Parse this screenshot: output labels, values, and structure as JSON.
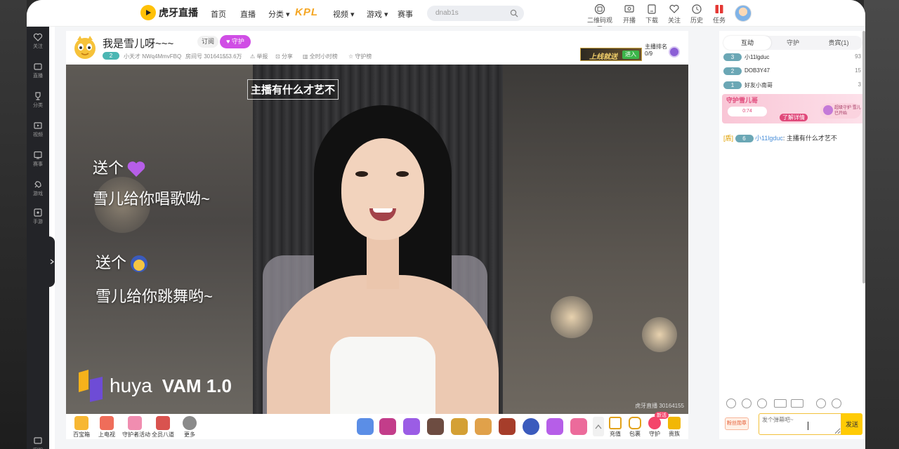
{
  "topnav": {
    "logo_text": "虎牙直播",
    "items": [
      "首页",
      "直播",
      "分类",
      "视频",
      "游戏",
      "赛事"
    ],
    "kpl": "KPL",
    "search_placeholder": "dnab1s",
    "icons": [
      {
        "label": "二维码观看"
      },
      {
        "label": "开播"
      },
      {
        "label": "下载"
      },
      {
        "label": "关注"
      },
      {
        "label": "历史"
      },
      {
        "label": "任务"
      }
    ]
  },
  "sidebar": {
    "items": [
      "关注",
      "直播",
      "分类",
      "视频",
      "赛事",
      "游戏",
      "手游"
    ],
    "bottom": "客服"
  },
  "room": {
    "title": "我是雪儿呀~~~",
    "subscribe": "订阅",
    "guard": "守护",
    "level": "2",
    "meta": [
      "小天才 NWq4MmvFBQ",
      "房间号 30164155",
      "3.6万",
      "举报",
      "分享",
      "全时小时榜",
      "守护榜"
    ],
    "ad_text": "上线就送",
    "ad_enter": "进入",
    "rank_label": "主播排名",
    "rank_value": "0/9"
  },
  "video": {
    "caption": "主播有什么才艺不",
    "line1": "送个",
    "line2": "雪儿给你唱歌呦~",
    "line3": "送个",
    "line4": "雪儿给你跳舞哟~",
    "brand": "huya",
    "version": "VAM 1.0",
    "room_no": "虎牙直播 30164155"
  },
  "giftbar": {
    "left": [
      "百宝箱",
      "上电视",
      "守护者活动",
      "全员八道",
      "更多"
    ],
    "right": [
      "充值",
      "包裹",
      "守护",
      "贵族"
    ],
    "hot": "新活"
  },
  "chat": {
    "tabs": [
      "互动",
      "守护",
      "贵宾(1)"
    ],
    "rank": [
      {
        "lv": "3",
        "name": "小11lgduc",
        "score": "93"
      },
      {
        "lv": "2",
        "name": "DOB3Y47",
        "score": "15"
      },
      {
        "lv": "1",
        "name": "好友小南哥",
        "score": "3"
      }
    ],
    "guard_title": "守护雪儿哥",
    "guard_timer": "0:74",
    "guard_know": "了解详情",
    "guard_card": "超级守护 雪儿已开始",
    "message": {
      "tag": "[盾]",
      "lv": "6",
      "name": "小11lgduc",
      "text": "主播有什么才艺不"
    },
    "input_badge": "粉丝勋章",
    "input_placeholder": "发个弹幕吧~",
    "send": "发送"
  }
}
